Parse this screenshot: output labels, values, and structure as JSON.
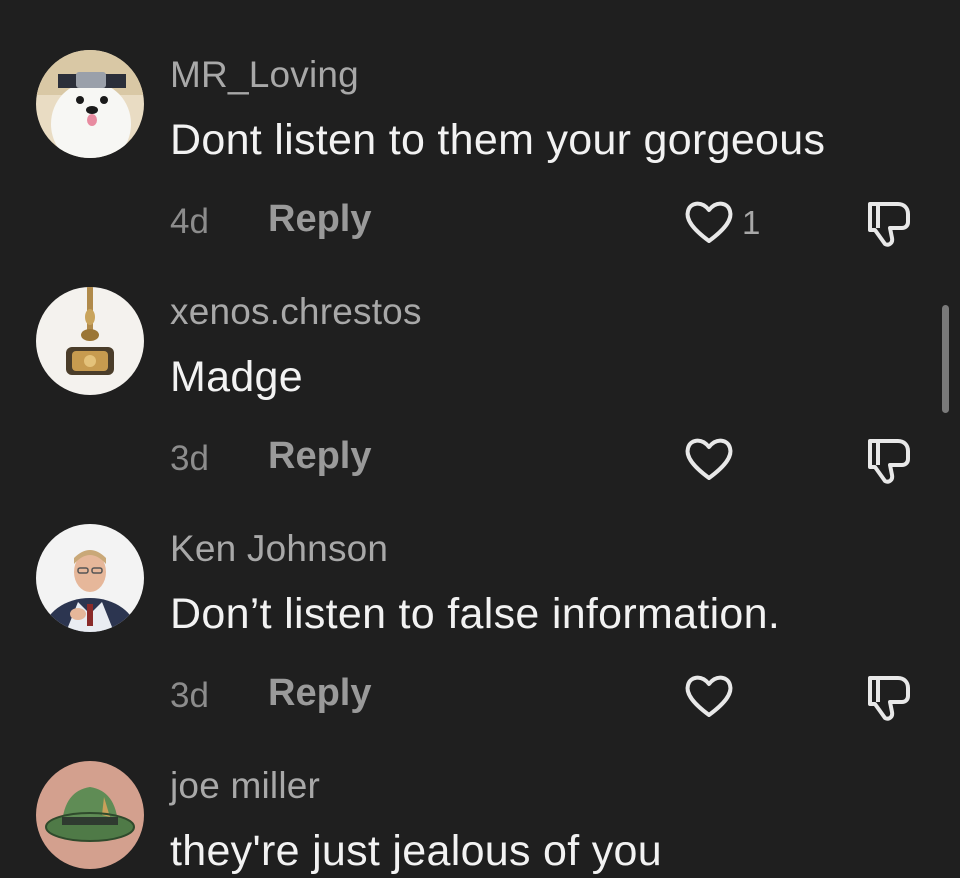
{
  "comments": [
    {
      "username": "MR_Loving",
      "text": "Dont listen to them your gorgeous",
      "time": "4d",
      "reply_label": "Reply",
      "like_count": "1",
      "avatar_icon": "polar-bear-avatar"
    },
    {
      "username": "xenos.chrestos",
      "text": "Madge",
      "time": "3d",
      "reply_label": "Reply",
      "like_count": "",
      "avatar_icon": "golden-ornament-avatar"
    },
    {
      "username": "Ken Johnson",
      "text": "Don’t listen to false information.",
      "time": "3d",
      "reply_label": "Reply",
      "like_count": "",
      "avatar_icon": "man-in-vest-avatar"
    },
    {
      "username": "joe miller",
      "text": "they're just jealous of you",
      "avatar_icon": "green-hat-avatar"
    }
  ],
  "colors": {
    "background": "#1f1f1f",
    "username": "#a8a8a8",
    "comment_text": "#f2f2f2",
    "meta": "#8c8c8c"
  }
}
